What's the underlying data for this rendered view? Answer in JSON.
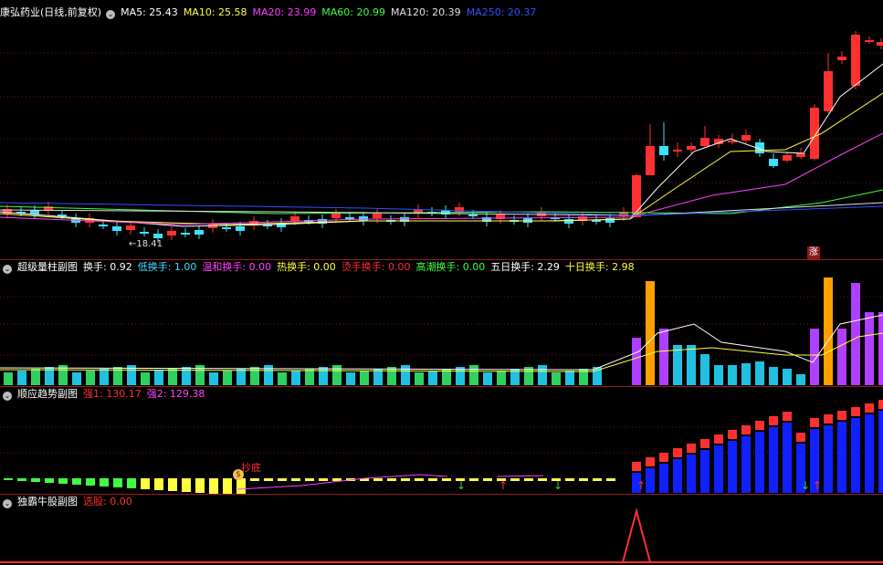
{
  "main": {
    "stock_name": "康弘药业(日线,前复权)",
    "ma": [
      {
        "label": "MA5: 25.43",
        "color": "#ffffff"
      },
      {
        "label": "MA10: 25.58",
        "color": "#ffff40"
      },
      {
        "label": "MA20: 23.99",
        "color": "#ff40ff"
      },
      {
        "label": "MA60: 20.99",
        "color": "#40ff40"
      },
      {
        "label": "MA120: 20.39",
        "color": "#e0e0e0"
      },
      {
        "label": "MA250: 20.37",
        "color": "#3050ff"
      }
    ],
    "low_label": "←18.41",
    "zhang_label": "涨"
  },
  "panel1": {
    "title": "超级量柱副图",
    "items": [
      {
        "label": "换手: 0.92",
        "color": "#ffffff"
      },
      {
        "label": "低换手: 1.00",
        "color": "#40e0ff"
      },
      {
        "label": "温和换手: 0.00",
        "color": "#ff40ff"
      },
      {
        "label": "热换手: 0.00",
        "color": "#ffff40"
      },
      {
        "label": "烫手换手: 0.00",
        "color": "#ff3030"
      },
      {
        "label": "高潮换手: 0.00",
        "color": "#40ff40"
      },
      {
        "label": "五日换手: 2.29",
        "color": "#ffffff"
      },
      {
        "label": "十日换手: 2.98",
        "color": "#ffff40"
      }
    ]
  },
  "panel2": {
    "title": "顺应趋势副图",
    "items": [
      {
        "label": "强1: 130.17",
        "color": "#ff3030"
      },
      {
        "label": "强2: 129.38",
        "color": "#ff40ff"
      }
    ],
    "marker_label": "抄底"
  },
  "panel3": {
    "title": "独霸牛股副图",
    "items": [
      {
        "label": "选股: 0.00",
        "color": "#ff3030"
      }
    ]
  },
  "colors": {
    "up": "#ff3030",
    "down": "#40e0ff",
    "separator": "#9a1b1b"
  }
}
